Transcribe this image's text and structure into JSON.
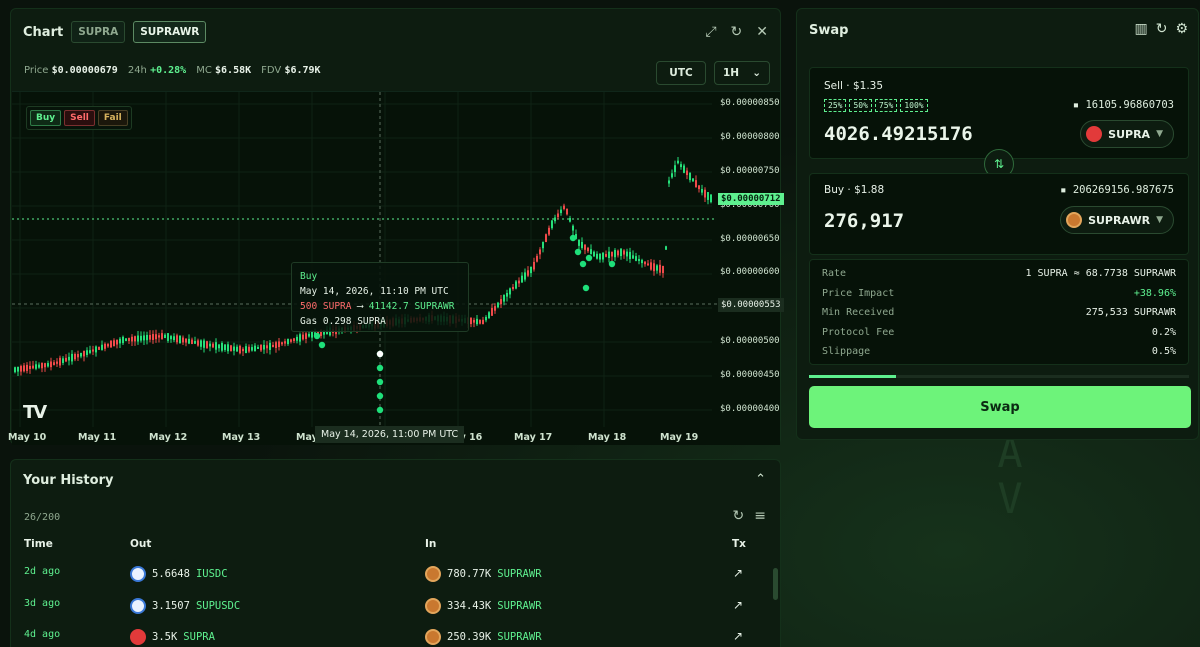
{
  "chart": {
    "title": "Chart",
    "tabs": [
      "SUPRA",
      "SUPRAWR"
    ],
    "active_tab": "SUPRAWR",
    "stats": {
      "price_label": "Price",
      "price": "$0.00000679",
      "change_label": "24h",
      "change": "+0.28%",
      "mc_label": "MC",
      "mc": "$6.58K",
      "fdv_label": "FDV",
      "fdv": "$6.79K"
    },
    "utc_label": "UTC",
    "timeframe": "1H",
    "legend": {
      "buy": "Buy",
      "sell": "Sell",
      "fail": "Fail"
    },
    "tooltip": {
      "type": "Buy",
      "date": "May 14, 2026, 11:10 PM UTC",
      "out": "500 SUPRA",
      "arrow": "⟶",
      "in": "41142.7 SUPRAWR",
      "gas": "Gas 0.298 SUPRA"
    },
    "current_price_tag": "$0.00000712",
    "crosshair_price_tag": "$0.00000553",
    "crosshair_time_tag": "May 14, 2026, 11:00 PM UTC",
    "x_labels": [
      "May 10",
      "May 11",
      "May 12",
      "May 13",
      "May",
      "May 16",
      "May 17",
      "May 18",
      "May 19"
    ],
    "y_labels": [
      "$0.00000850",
      "$0.00000800",
      "$0.00000750",
      "$0.00000700",
      "$0.00000650",
      "$0.00000600",
      "$0.00000500",
      "$0.00000450",
      "$0.00000400"
    ],
    "tv_logo": "TV"
  },
  "history": {
    "title": "Your History",
    "count": "26/200",
    "columns": {
      "time": "Time",
      "out": "Out",
      "in": "In",
      "tx": "Tx"
    },
    "rows": [
      {
        "time": "2d ago",
        "out_amt": "5.6648",
        "out_sym": "IUSDC",
        "out_icon": "usdc",
        "in_amt": "780.77K",
        "in_sym": "SUPRAWR"
      },
      {
        "time": "3d ago",
        "out_amt": "3.1507",
        "out_sym": "SUPUSDC",
        "out_icon": "usdc",
        "in_amt": "334.43K",
        "in_sym": "SUPRAWR"
      },
      {
        "time": "4d ago",
        "out_amt": "3.5K",
        "out_sym": "SUPRA",
        "out_icon": "supra",
        "in_amt": "250.39K",
        "in_sym": "SUPRAWR"
      }
    ]
  },
  "swap": {
    "title": "Swap",
    "sell": {
      "label": "Sell · $1.35",
      "pcts": [
        "25%",
        "50%",
        "75%",
        "100%"
      ],
      "balance": "16105.96860703",
      "amount": "4026.49215176",
      "token": "SUPRA"
    },
    "buy": {
      "label": "Buy · $1.88",
      "balance": "206269156.987675",
      "amount": "276,917",
      "token": "SUPRAWR"
    },
    "info": [
      {
        "k": "Rate",
        "v": "1 SUPRA ≈ 68.7738 SUPRAWR"
      },
      {
        "k": "Price Impact",
        "v": "+38.96%"
      },
      {
        "k": "Min Received",
        "v": "275,533 SUPRAWR"
      },
      {
        "k": "Protocol Fee",
        "v": "0.2%"
      },
      {
        "k": "Slippage",
        "v": "0.5%"
      }
    ],
    "progress": 0.23,
    "button": "Swap"
  },
  "background": {
    "letters": [
      "A",
      "V"
    ]
  },
  "colors": {
    "accent": "#5ef08f",
    "sell": "#ff4d4d",
    "button": "#6df37a",
    "panel": "#0d1c10"
  }
}
